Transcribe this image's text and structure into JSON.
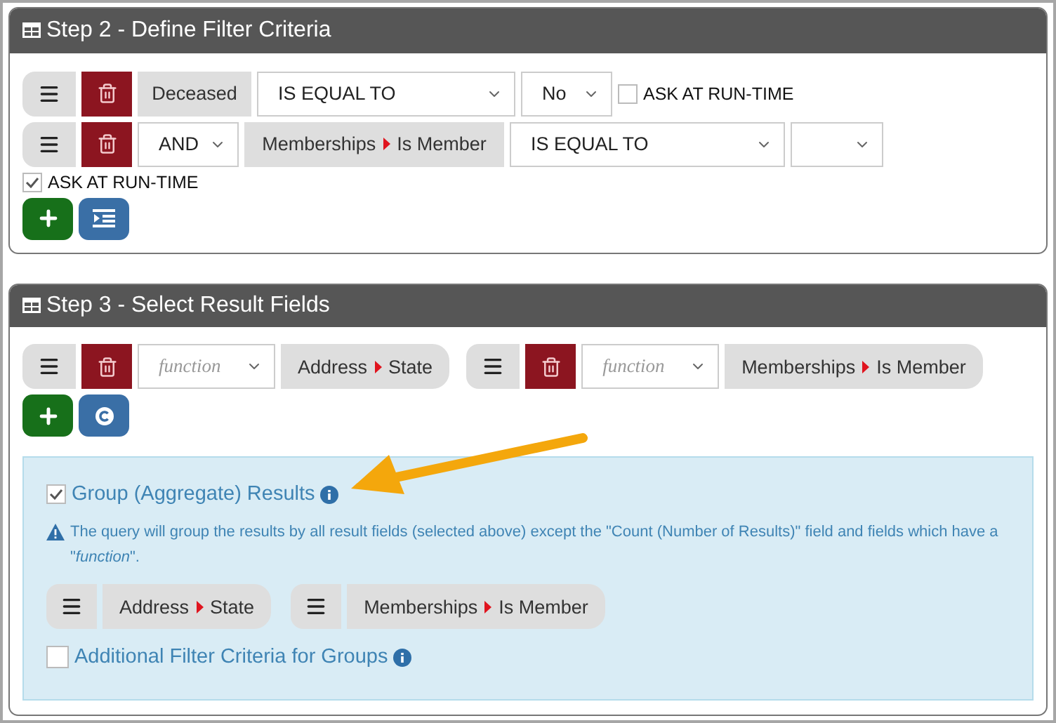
{
  "step2": {
    "title": "Step 2 - Define Filter Criteria",
    "criteria": [
      {
        "field": [
          "Deceased"
        ],
        "operator": "IS EQUAL TO",
        "value": "No",
        "ask": {
          "label": "ASK AT RUN-TIME",
          "checked": false
        }
      },
      {
        "conjunction": "AND",
        "field": [
          "Memberships",
          "Is Member"
        ],
        "operator": "IS EQUAL TO",
        "ask": {
          "label": "ASK AT RUN-TIME",
          "checked": true
        }
      }
    ]
  },
  "step3": {
    "title": "Step 3 - Select Result Fields",
    "fields": [
      {
        "function_placeholder": "function",
        "path": [
          "Address",
          "State"
        ]
      },
      {
        "function_placeholder": "function",
        "path": [
          "Memberships",
          "Is Member"
        ]
      }
    ],
    "group": {
      "label": "Group (Aggregate) Results",
      "checked": true,
      "note": "The query will group the results by all result fields (selected above) except the \"Count (Number of Results)\" field and fields which have a \"*function*\".",
      "fields": [
        [
          "Address",
          "State"
        ],
        [
          "Memberships",
          "Is Member"
        ]
      ],
      "additional": {
        "label": "Additional Filter Criteria for Groups",
        "checked": false
      }
    }
  }
}
